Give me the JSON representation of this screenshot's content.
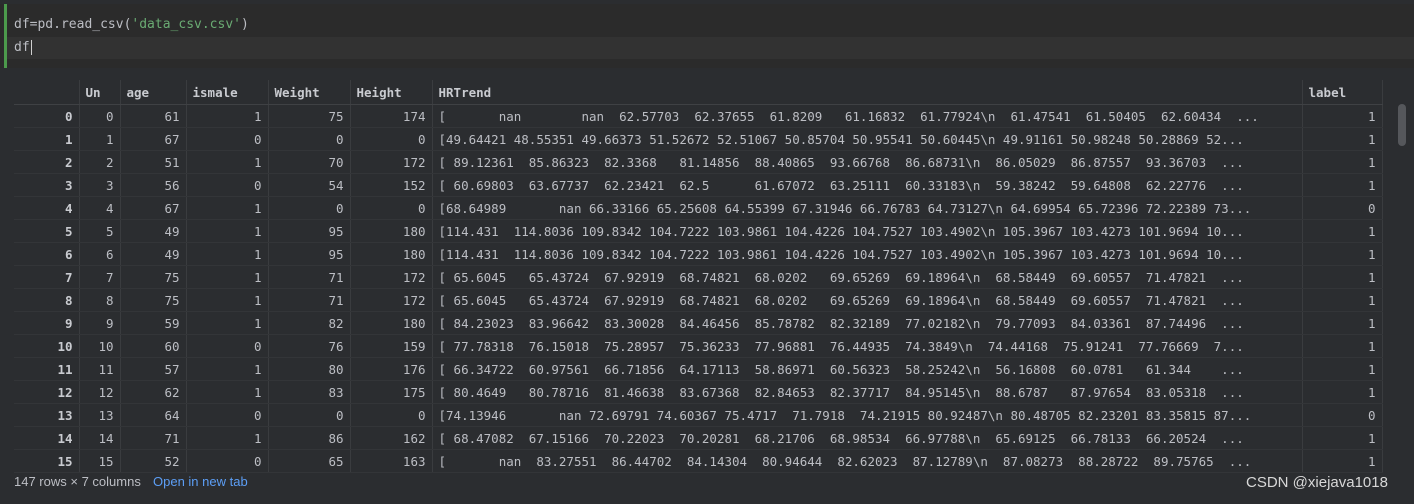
{
  "editor": {
    "line1_prefix": "df=pd.read_csv(",
    "line1_string": "'data_csv.csv'",
    "line1_suffix": ")",
    "line2": "df"
  },
  "table": {
    "columns": [
      "",
      "Un",
      "age",
      "ismale",
      "Weight",
      "Height",
      "HRTrend",
      "label"
    ],
    "rows": [
      [
        "0",
        "0",
        "61",
        "1",
        "75",
        "174",
        "[       nan        nan  62.57703  62.37655  61.8209   61.16832  61.77924\\n  61.47541  61.50405  62.60434  ...",
        "1"
      ],
      [
        "1",
        "1",
        "67",
        "0",
        "0",
        "0",
        "[49.64421 48.55351 49.66373 51.52672 52.51067 50.85704 50.95541 50.60445\\n 49.91161 50.98248 50.28869 52...",
        "1"
      ],
      [
        "2",
        "2",
        "51",
        "1",
        "70",
        "172",
        "[ 89.12361  85.86323  82.3368   81.14856  88.40865  93.66768  86.68731\\n  86.05029  86.87557  93.36703  ...",
        "1"
      ],
      [
        "3",
        "3",
        "56",
        "0",
        "54",
        "152",
        "[ 60.69803  63.67737  62.23421  62.5      61.67072  63.25111  60.33183\\n  59.38242  59.64808  62.22776  ...",
        "1"
      ],
      [
        "4",
        "4",
        "67",
        "1",
        "0",
        "0",
        "[68.64989       nan 66.33166 65.25608 64.55399 67.31946 66.76783 64.73127\\n 64.69954 65.72396 72.22389 73...",
        "0"
      ],
      [
        "5",
        "5",
        "49",
        "1",
        "95",
        "180",
        "[114.431  114.8036 109.8342 104.7222 103.9861 104.4226 104.7527 103.4902\\n 105.3967 103.4273 101.9694 10...",
        "1"
      ],
      [
        "6",
        "6",
        "49",
        "1",
        "95",
        "180",
        "[114.431  114.8036 109.8342 104.7222 103.9861 104.4226 104.7527 103.4902\\n 105.3967 103.4273 101.9694 10...",
        "1"
      ],
      [
        "7",
        "7",
        "75",
        "1",
        "71",
        "172",
        "[ 65.6045   65.43724  67.92919  68.74821  68.0202   69.65269  69.18964\\n  68.58449  69.60557  71.47821  ...",
        "1"
      ],
      [
        "8",
        "8",
        "75",
        "1",
        "71",
        "172",
        "[ 65.6045   65.43724  67.92919  68.74821  68.0202   69.65269  69.18964\\n  68.58449  69.60557  71.47821  ...",
        "1"
      ],
      [
        "9",
        "9",
        "59",
        "1",
        "82",
        "180",
        "[ 84.23023  83.96642  83.30028  84.46456  85.78782  82.32189  77.02182\\n  79.77093  84.03361  87.74496  ...",
        "1"
      ],
      [
        "10",
        "10",
        "60",
        "0",
        "76",
        "159",
        "[ 77.78318  76.15018  75.28957  75.36233  77.96881  76.44935  74.3849\\n  74.44168  75.91241  77.76669  7...",
        "1"
      ],
      [
        "11",
        "11",
        "57",
        "1",
        "80",
        "176",
        "[ 66.34722  60.97561  66.71856  64.17113  58.86971  60.56323  58.25242\\n  56.16808  60.0781   61.344    ...",
        "1"
      ],
      [
        "12",
        "12",
        "62",
        "1",
        "83",
        "175",
        "[ 80.4649   80.78716  81.46638  83.67368  82.84653  82.37717  84.95145\\n  88.6787   87.97654  83.05318  ...",
        "1"
      ],
      [
        "13",
        "13",
        "64",
        "0",
        "0",
        "0",
        "[74.13946       nan 72.69791 74.60367 75.4717  71.7918  74.21915 80.92487\\n 80.48705 82.23201 83.35815 87...",
        "0"
      ],
      [
        "14",
        "14",
        "71",
        "1",
        "86",
        "162",
        "[ 68.47082  67.15166  70.22023  70.20281  68.21706  68.98534  66.97788\\n  65.69125  66.78133  66.20524  ...",
        "1"
      ],
      [
        "15",
        "15",
        "52",
        "0",
        "65",
        "163",
        "[       nan  83.27551  86.44702  84.14304  80.94644  82.62023  87.12789\\n  87.08273  88.28722  89.75765  ...",
        "1"
      ]
    ]
  },
  "footer": {
    "rows_info": "147 rows × 7 columns",
    "open_tab": "Open in new tab"
  },
  "watermark": "CSDN @xiejava1018"
}
